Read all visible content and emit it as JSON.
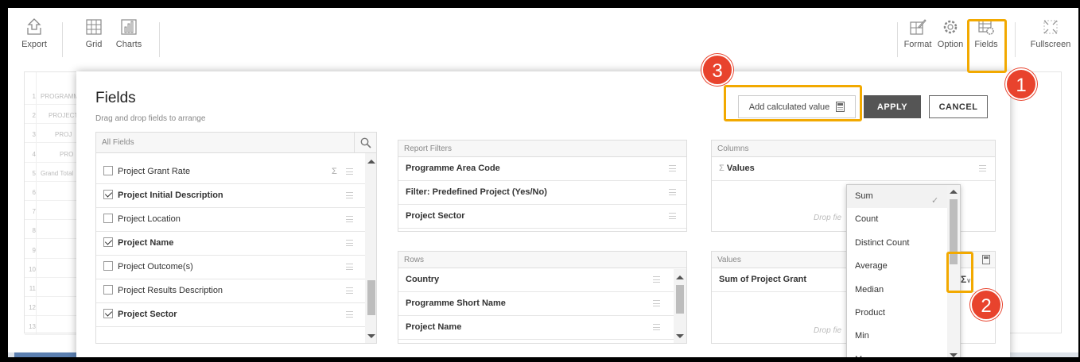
{
  "toolbar": {
    "left": [
      {
        "label": "Export",
        "icon": "export-icon"
      },
      {
        "label": "Grid",
        "icon": "grid-icon"
      },
      {
        "label": "Charts",
        "icon": "charts-icon"
      }
    ],
    "right": [
      {
        "label": "Format",
        "icon": "format-icon"
      },
      {
        "label": "Option",
        "icon": "options-gear-icon"
      },
      {
        "label": "Fields",
        "icon": "fields-icon"
      },
      {
        "label": "Fullscreen",
        "icon": "fullscreen-icon"
      }
    ]
  },
  "background_grid": {
    "rows": [
      {
        "num": "1",
        "text": "PROGRAMME"
      },
      {
        "num": "2",
        "text": "PROJECT"
      },
      {
        "num": "3",
        "text": "PROJ"
      },
      {
        "num": "4",
        "text": "PRO"
      },
      {
        "num": "5",
        "text": "Grand Total"
      },
      {
        "num": "6",
        "text": ""
      },
      {
        "num": "7",
        "text": ""
      },
      {
        "num": "8",
        "text": ""
      },
      {
        "num": "9",
        "text": ""
      },
      {
        "num": "10",
        "text": ""
      },
      {
        "num": "11",
        "text": ""
      },
      {
        "num": "12",
        "text": ""
      },
      {
        "num": "13",
        "text": ""
      }
    ]
  },
  "modal": {
    "title": "Fields",
    "subtitle": "Drag and drop fields to arrange",
    "add_calculated_label": "Add calculated value",
    "apply_label": "APPLY",
    "cancel_label": "CANCEL",
    "all_fields": {
      "header": "All Fields",
      "items": [
        {
          "label": "Project Grant Rate",
          "checked": false,
          "bold": false,
          "sigma": true
        },
        {
          "label": "Project Initial Description",
          "checked": true,
          "bold": true,
          "sigma": false
        },
        {
          "label": "Project Location",
          "checked": false,
          "bold": false,
          "sigma": false
        },
        {
          "label": "Project Name",
          "checked": true,
          "bold": true,
          "sigma": false
        },
        {
          "label": "Project Outcome(s)",
          "checked": false,
          "bold": false,
          "sigma": false
        },
        {
          "label": "Project Results Description",
          "checked": false,
          "bold": false,
          "sigma": false
        },
        {
          "label": "Project Sector",
          "checked": true,
          "bold": true,
          "sigma": false
        }
      ]
    },
    "report_filters": {
      "header": "Report Filters",
      "items": [
        "Programme Area Code",
        "Filter: Predefined Project (Yes/No)",
        "Project Sector"
      ]
    },
    "rows": {
      "header": "Rows",
      "items": [
        "Country",
        "Programme Short Name",
        "Project Name"
      ]
    },
    "columns": {
      "header": "Columns",
      "items": [
        "Values"
      ],
      "drop_hint": "Drop fie"
    },
    "values": {
      "header": "Values",
      "items": [
        "Sum of Project Grant"
      ],
      "drop_hint": "Drop fie"
    }
  },
  "aggregation_dropdown": {
    "selected": "Sum",
    "options": [
      "Sum",
      "Count",
      "Distinct Count",
      "Average",
      "Median",
      "Product",
      "Min",
      "Max"
    ]
  },
  "annotations": {
    "badge_1": "1",
    "badge_2": "2",
    "badge_3": "3"
  },
  "colors": {
    "highlight": "#f2a900",
    "badge": "#e8432d",
    "apply_bg": "#555555"
  }
}
